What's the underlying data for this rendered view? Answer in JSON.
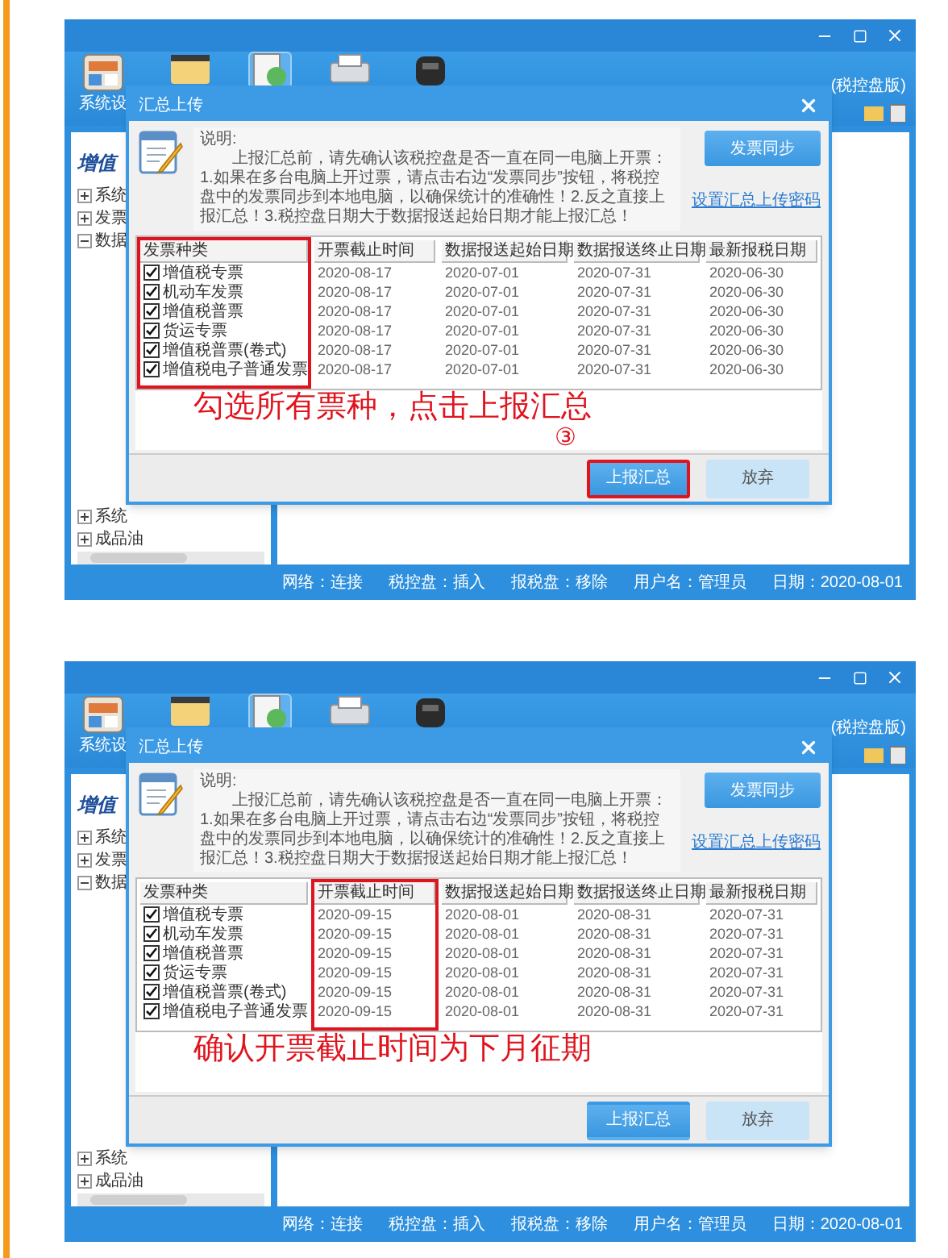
{
  "screens": [
    {
      "window": {
        "title": "(税控盘版)",
        "tools": [
          {
            "label": "系统设",
            "selected": false
          },
          {
            "selected": false
          },
          {
            "selected": true
          },
          {
            "selected": false
          },
          {
            "selected": false
          }
        ]
      },
      "sidebar": {
        "title": "增值",
        "items": [
          {
            "label": "系统",
            "expanded": false
          },
          {
            "label": "发票",
            "expanded": false
          },
          {
            "label": "数据",
            "expanded": true
          }
        ],
        "bottom_items": [
          {
            "label": "系统",
            "expanded": false
          },
          {
            "label": "成品油",
            "expanded": false
          }
        ]
      },
      "dialog": {
        "title": "汇总上传",
        "notice_label": "说明:",
        "notice": "上报汇总前，请先确认该税控盘是否一直在同一电脑上开票：1.如果在多台电脑上开过票，请点击右边“发票同步”按钮，将税控盘中的发票同步到本地电脑，以确保统计的准确性！2.反之直接上报汇总！3.税控盘日期大于数据报送起始日期才能上报汇总！",
        "sync_button": "发票同步",
        "password_link": "设置汇总上传密码",
        "table": {
          "columns": [
            {
              "label": "发票种类",
              "highlighted": true
            },
            {
              "label": "开票截止时间",
              "highlighted": false
            },
            {
              "label": "数据报送起始日期",
              "highlighted": false
            },
            {
              "label": "数据报送终止日期",
              "highlighted": false
            },
            {
              "label": "最新报税日期",
              "highlighted": false
            }
          ],
          "rows": [
            {
              "checked": true,
              "cells": [
                "增值税专票",
                "2020-08-17",
                "2020-07-01",
                "2020-07-31",
                "2020-06-30"
              ]
            },
            {
              "checked": true,
              "cells": [
                "机动车发票",
                "2020-08-17",
                "2020-07-01",
                "2020-07-31",
                "2020-06-30"
              ]
            },
            {
              "checked": true,
              "cells": [
                "增值税普票",
                "2020-08-17",
                "2020-07-01",
                "2020-07-31",
                "2020-06-30"
              ]
            },
            {
              "checked": true,
              "cells": [
                "货运专票",
                "2020-08-17",
                "2020-07-01",
                "2020-07-31",
                "2020-06-30"
              ]
            },
            {
              "checked": true,
              "cells": [
                "增值税普票(卷式)",
                "2020-08-17",
                "2020-07-01",
                "2020-07-31",
                "2020-06-30"
              ]
            },
            {
              "checked": true,
              "cells": [
                "增值税电子普通发票",
                "2020-08-17",
                "2020-07-01",
                "2020-07-31",
                "2020-06-30"
              ]
            }
          ]
        },
        "annotation": "勾选所有票种，点击上报汇总",
        "step": "③",
        "buttons": [
          {
            "label": "上报汇总",
            "kind": "primary",
            "highlighted": true
          },
          {
            "label": "放弃",
            "kind": "secondary",
            "highlighted": false
          }
        ]
      },
      "status_bar": [
        "网络：连接",
        "税控盘：插入",
        "报税盘：移除",
        "用户名：管理员",
        "日期：2020-08-01"
      ]
    },
    {
      "window": {
        "title": "(税控盘版)",
        "tools": [
          {
            "label": "系统设",
            "selected": false
          },
          {
            "selected": false
          },
          {
            "selected": true
          },
          {
            "selected": false
          },
          {
            "selected": false
          }
        ]
      },
      "sidebar": {
        "title": "增值",
        "items": [
          {
            "label": "系统",
            "expanded": false
          },
          {
            "label": "发票",
            "expanded": false
          },
          {
            "label": "数据",
            "expanded": true
          }
        ],
        "bottom_items": [
          {
            "label": "系统",
            "expanded": false
          },
          {
            "label": "成品油",
            "expanded": false
          }
        ]
      },
      "dialog": {
        "title": "汇总上传",
        "notice_label": "说明:",
        "notice": "上报汇总前，请先确认该税控盘是否一直在同一电脑上开票：1.如果在多台电脑上开过票，请点击右边“发票同步”按钮，将税控盘中的发票同步到本地电脑，以确保统计的准确性！2.反之直接上报汇总！3.税控盘日期大于数据报送起始日期才能上报汇总！",
        "sync_button": "发票同步",
        "password_link": "设置汇总上传密码",
        "table": {
          "columns": [
            {
              "label": "发票种类",
              "highlighted": false
            },
            {
              "label": "开票截止时间",
              "highlighted": true
            },
            {
              "label": "数据报送起始日期",
              "highlighted": false
            },
            {
              "label": "数据报送终止日期",
              "highlighted": false
            },
            {
              "label": "最新报税日期",
              "highlighted": false
            }
          ],
          "rows": [
            {
              "checked": true,
              "cells": [
                "增值税专票",
                "2020-09-15",
                "2020-08-01",
                "2020-08-31",
                "2020-07-31"
              ]
            },
            {
              "checked": true,
              "cells": [
                "机动车发票",
                "2020-09-15",
                "2020-08-01",
                "2020-08-31",
                "2020-07-31"
              ]
            },
            {
              "checked": true,
              "cells": [
                "增值税普票",
                "2020-09-15",
                "2020-08-01",
                "2020-08-31",
                "2020-07-31"
              ]
            },
            {
              "checked": true,
              "cells": [
                "货运专票",
                "2020-09-15",
                "2020-08-01",
                "2020-08-31",
                "2020-07-31"
              ]
            },
            {
              "checked": true,
              "cells": [
                "增值税普票(卷式)",
                "2020-09-15",
                "2020-08-01",
                "2020-08-31",
                "2020-07-31"
              ]
            },
            {
              "checked": true,
              "cells": [
                "增值税电子普通发票",
                "2020-09-15",
                "2020-08-01",
                "2020-08-31",
                "2020-07-31"
              ]
            }
          ]
        },
        "annotation": "确认开票截止时间为下月征期",
        "buttons": [
          {
            "label": "上报汇总",
            "kind": "primary",
            "highlighted": false
          },
          {
            "label": "放弃",
            "kind": "secondary",
            "highlighted": false
          }
        ]
      },
      "status_bar": [
        "网络：连接",
        "税控盘：插入",
        "报税盘：移除",
        "用户名：管理员",
        "日期：2020-08-01"
      ]
    }
  ]
}
